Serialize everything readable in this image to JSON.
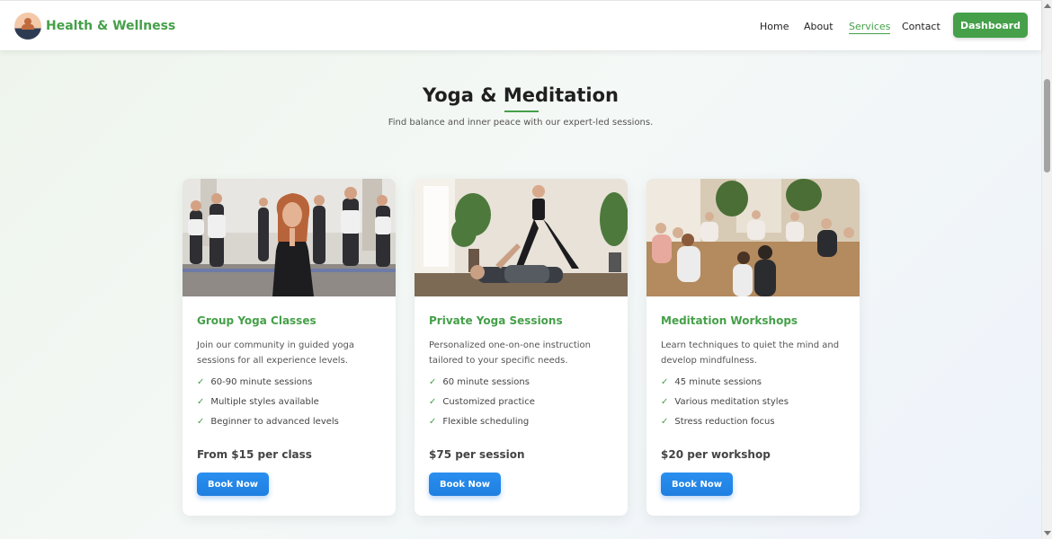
{
  "brand": {
    "name": "Health & Wellness",
    "logo_icon": "meditation-avatar-icon"
  },
  "nav": {
    "links": [
      {
        "label": "Home",
        "active": false
      },
      {
        "label": "About",
        "active": false
      },
      {
        "label": "Services",
        "active": true
      },
      {
        "label": "Contact",
        "active": false
      }
    ],
    "dashboard_label": "Dashboard"
  },
  "section": {
    "title": "Yoga & Meditation",
    "subtitle": "Find balance and inner peace with our expert-led sessions."
  },
  "cards": [
    {
      "title": "Group Yoga Classes",
      "description": "Join our community in guided yoga sessions for all experience levels.",
      "features": [
        "60-90 minute sessions",
        "Multiple styles available",
        "Beginner to advanced levels"
      ],
      "price": "From $15 per class",
      "button": "Book Now"
    },
    {
      "title": "Private Yoga Sessions",
      "description": "Personalized one-on-one instruction tailored to your specific needs.",
      "features": [
        "60 minute sessions",
        "Customized practice",
        "Flexible scheduling"
      ],
      "price": "$75 per session",
      "button": "Book Now"
    },
    {
      "title": "Meditation Workshops",
      "description": "Learn techniques to quiet the mind and develop mindfulness.",
      "features": [
        "45 minute sessions",
        "Various meditation styles",
        "Stress reduction focus"
      ],
      "price": "$20 per workshop",
      "button": "Book Now"
    }
  ],
  "check_glyph": "✓",
  "colors": {
    "accent_green": "#45a049",
    "button_blue": "#1f7fe0"
  }
}
